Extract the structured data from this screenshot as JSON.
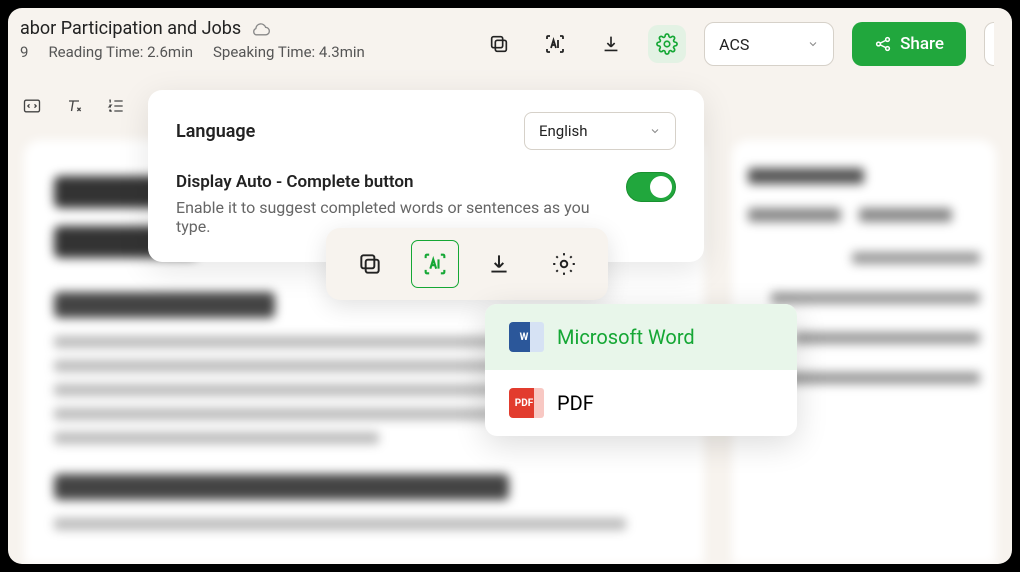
{
  "header": {
    "title_fragment": "abor Participation and Jobs",
    "word_count_prefix": "9",
    "reading_time": "Reading Time: 2.6min",
    "speaking_time": "Speaking Time: 4.3min",
    "style_select": "ACS",
    "share_label": "Share"
  },
  "settings": {
    "language_label": "Language",
    "language_value": "English",
    "autocomplete_title": "Display Auto - Complete button",
    "autocomplete_desc": "Enable it to suggest completed words or sentences as you type.",
    "autocomplete_on": true
  },
  "download_menu": {
    "word": "Microsoft Word",
    "pdf": "PDF"
  }
}
